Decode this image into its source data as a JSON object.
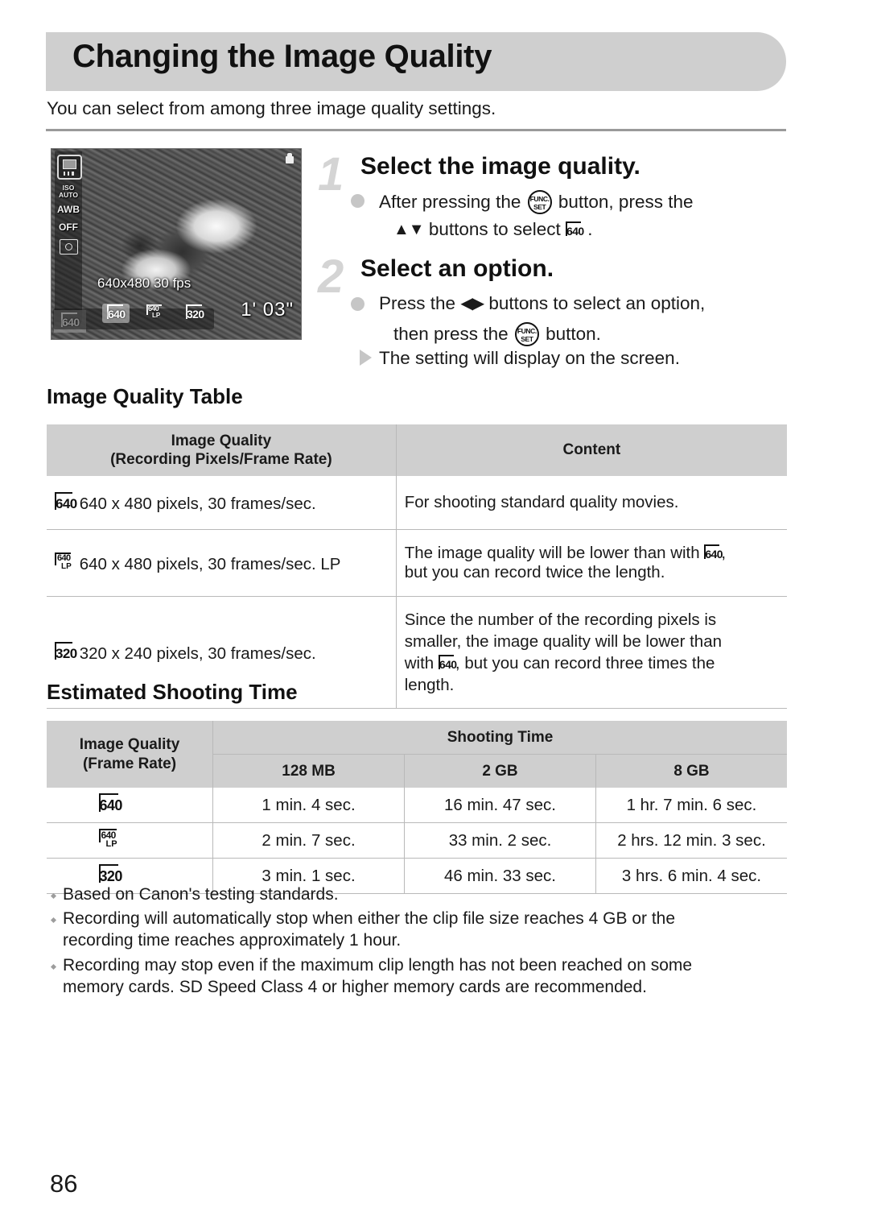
{
  "header": {
    "title": "Changing the Image Quality",
    "intro": "You can select from among three image quality settings."
  },
  "camera_screen": {
    "resolution_label": "640x480 30 fps",
    "time_remaining": "1' 03\"",
    "iso_label": "ISO",
    "iso_value": "AUTO",
    "white_balance": "AWB",
    "flash": "OFF",
    "options": [
      {
        "num": "640",
        "lp": "",
        "selected": true
      },
      {
        "num": "640",
        "lp": "LP",
        "selected": false
      },
      {
        "num": "320",
        "lp": "",
        "selected": false
      }
    ],
    "selected_badge": {
      "num": "640",
      "lp": ""
    }
  },
  "steps": [
    {
      "number": "1",
      "heading": "Select the image quality.",
      "lines": [
        {
          "marker": "dot",
          "pre": "After pressing the",
          "icon": "func-set",
          "mid": "button, press the",
          "post": ""
        },
        {
          "marker": "none",
          "pre": "",
          "icon": "updown-arrows",
          "mid": "buttons to select",
          "badge": "640",
          "post": "."
        }
      ]
    },
    {
      "number": "2",
      "heading": "Select an option.",
      "lines": [
        {
          "marker": "dot",
          "pre": "Press the",
          "icon": "leftright-arrows",
          "mid": "buttons to select an option,",
          "post": ""
        },
        {
          "marker": "none",
          "pre": "then press the",
          "icon": "func-set",
          "mid": "button.",
          "post": ""
        },
        {
          "marker": "triangle",
          "pre": "The setting will display on the screen.",
          "icon": "",
          "mid": "",
          "post": ""
        }
      ]
    }
  ],
  "quality_table": {
    "heading": "Image Quality Table",
    "columns": [
      {
        "line1": "Image Quality",
        "line2": "(Recording Pixels/Frame Rate)"
      },
      {
        "line1": "Content",
        "line2": ""
      }
    ],
    "rows": [
      {
        "badge": {
          "num": "640",
          "lp": ""
        },
        "spec": "640 x 480 pixels, 30 frames/sec.",
        "content_parts": [
          {
            "text": "For shooting standard quality movies."
          }
        ]
      },
      {
        "badge": {
          "num": "640",
          "lp": "LP"
        },
        "spec": "640 x 480 pixels, 30 frames/sec. LP",
        "content_parts": [
          {
            "text": "The image quality will be lower than with"
          },
          {
            "badge": {
              "num": "640",
              "lp": ""
            }
          },
          {
            "text": ","
          },
          {
            "break": true
          },
          {
            "text": "but you can record twice the length."
          }
        ]
      },
      {
        "badge": {
          "num": "320",
          "lp": ""
        },
        "spec": "320 x 240 pixels, 30 frames/sec.",
        "content_parts": [
          {
            "text": "Since the number of the recording pixels is"
          },
          {
            "break": true
          },
          {
            "text": "smaller, the image quality will be lower than"
          },
          {
            "break": true
          },
          {
            "text": "with"
          },
          {
            "badge": {
              "num": "640",
              "lp": ""
            }
          },
          {
            "text": ", but you can record three times the"
          },
          {
            "break": true
          },
          {
            "text": "length."
          }
        ]
      }
    ]
  },
  "shooting_time": {
    "heading": "Estimated Shooting Time",
    "col_quality_line1": "Image Quality",
    "col_quality_line2": "(Frame Rate)",
    "col_group": "Shooting Time",
    "capacities": [
      "128 MB",
      "2 GB",
      "8 GB"
    ],
    "rows": [
      {
        "badge": {
          "num": "640",
          "lp": ""
        },
        "times": [
          "1 min. 4 sec.",
          "16 min. 47 sec.",
          "1 hr. 7 min. 6 sec."
        ]
      },
      {
        "badge": {
          "num": "640",
          "lp": "LP"
        },
        "times": [
          "2 min. 7 sec.",
          "33 min. 2 sec.",
          "2 hrs. 12 min. 3 sec."
        ]
      },
      {
        "badge": {
          "num": "320",
          "lp": ""
        },
        "times": [
          "3 min. 1 sec.",
          "46 min. 33 sec.",
          "3 hrs. 6 min. 4 sec."
        ]
      }
    ]
  },
  "footnotes": [
    [
      "Based on Canon's testing standards."
    ],
    [
      "Recording will automatically stop when either the clip file size reaches 4 GB or the",
      "recording time reaches approximately 1 hour."
    ],
    [
      "Recording may stop even if the maximum clip length has not been reached on some",
      "memory cards. SD Speed Class 4 or higher memory cards are recommended."
    ]
  ],
  "page_number": "86",
  "colors": {
    "band": "#cfcfcf",
    "rule": "#9a9a9a",
    "gray_accent": "#c6c6c6",
    "table_border": "#b9b9b9"
  }
}
